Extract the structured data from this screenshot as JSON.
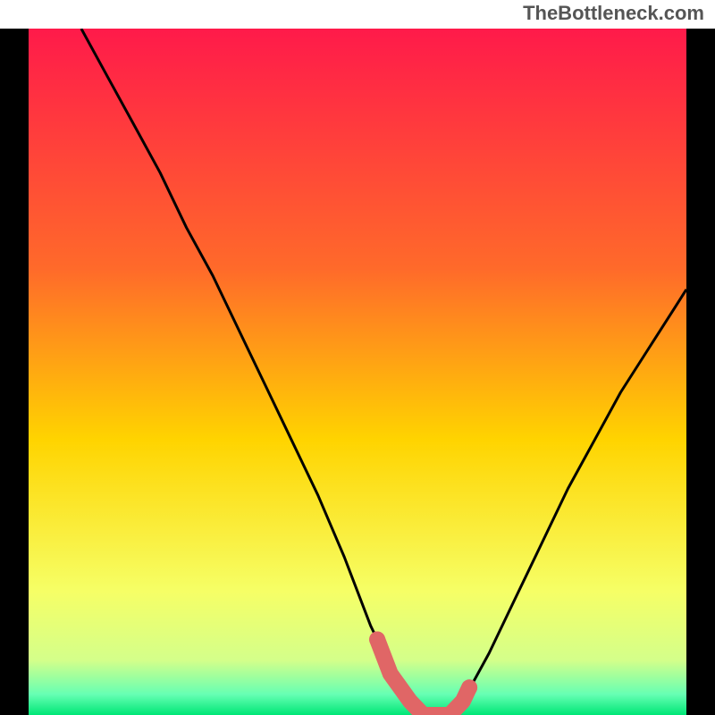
{
  "watermark": "TheBottleneck.com",
  "chart_data": {
    "type": "line",
    "title": "",
    "xlabel": "",
    "ylabel": "",
    "xlim": [
      0,
      100
    ],
    "ylim": [
      0,
      100
    ],
    "series": [
      {
        "name": "bottleneck-curve",
        "x": [
          8,
          12,
          16,
          20,
          24,
          28,
          32,
          36,
          40,
          44,
          48,
          52,
          53,
          56,
          58,
          60,
          62,
          64,
          66,
          70,
          74,
          78,
          82,
          86,
          90,
          94,
          98,
          100
        ],
        "y": [
          100,
          93,
          86,
          79,
          71,
          64,
          56,
          48,
          40,
          32,
          23,
          13,
          11,
          5,
          2,
          0,
          0,
          0,
          2,
          9,
          17,
          25,
          33,
          40,
          47,
          53,
          59,
          62
        ]
      },
      {
        "name": "optimal-zone",
        "x": [
          53,
          55,
          58,
          60,
          62,
          64,
          66,
          67
        ],
        "y": [
          11,
          6,
          2,
          0,
          0,
          0,
          2,
          4
        ]
      }
    ],
    "gradient_stops": [
      {
        "offset": 0,
        "color": "#ff1a4a"
      },
      {
        "offset": 35,
        "color": "#ff6a2a"
      },
      {
        "offset": 60,
        "color": "#ffd400"
      },
      {
        "offset": 82,
        "color": "#f6ff66"
      },
      {
        "offset": 92,
        "color": "#d4ff8a"
      },
      {
        "offset": 97,
        "color": "#66ffb3"
      },
      {
        "offset": 100,
        "color": "#00e676"
      }
    ],
    "colors": {
      "curve": "#000000",
      "optimal_band": "#e06666",
      "frame": "#000000"
    }
  }
}
